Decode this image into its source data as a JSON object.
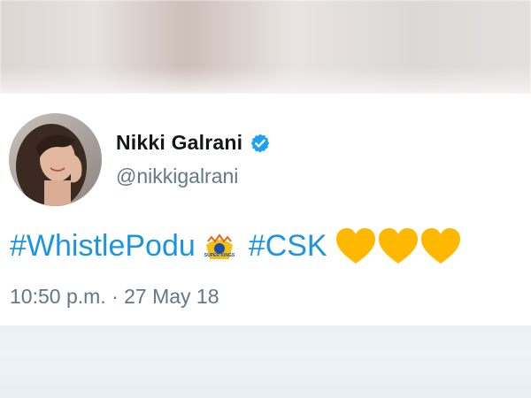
{
  "tweet": {
    "author_name": "Nikki Galrani",
    "handle": "@nikkigalrani",
    "hashtag_1": "#WhistlePodu",
    "hashtag_2": "#CSK",
    "timestamp": "10:50 p.m. · 27 May 18",
    "verified": true,
    "csk_logo_text": "SUPER KINGS",
    "heart_count": 3
  },
  "colors": {
    "link": "#1b95e0",
    "verified_badge": "#1da1f2",
    "name": "#14171a",
    "secondary_text": "#657786",
    "heart": "#ffb800"
  },
  "icons": {
    "verified": "verified-badge-icon",
    "team_logo": "csk-logo-icon",
    "heart": "yellow-heart-icon"
  }
}
